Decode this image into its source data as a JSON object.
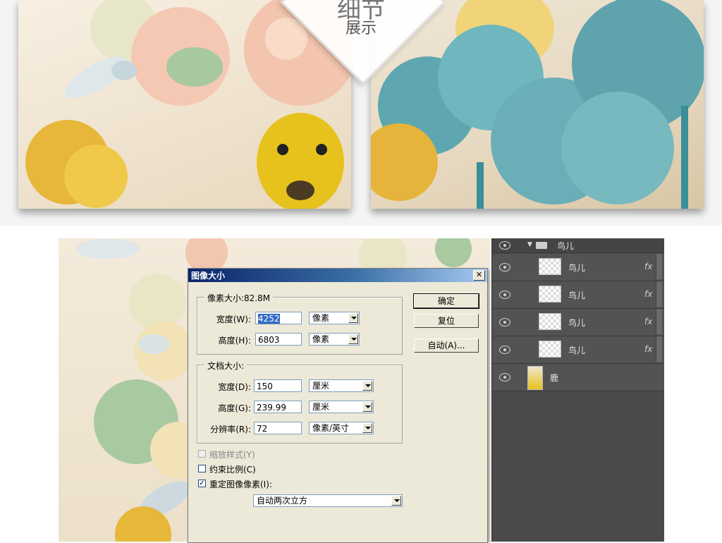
{
  "banner": {
    "title": "细节",
    "subtitle": "展示"
  },
  "dialog": {
    "title": "图像大小",
    "close": "✕",
    "pixel_group": {
      "legend": "像素大小:82.8M",
      "width_label": "宽度(W):",
      "width_value": "4252",
      "width_unit": "像素",
      "height_label": "高度(H):",
      "height_value": "6803",
      "height_unit": "像素"
    },
    "doc_group": {
      "legend": "文档大小:",
      "width_label": "宽度(D):",
      "width_value": "150",
      "width_unit": "厘米",
      "height_label": "高度(G):",
      "height_value": "239.99",
      "height_unit": "厘米",
      "res_label": "分辨率(R):",
      "res_value": "72",
      "res_unit": "像素/英寸"
    },
    "buttons": {
      "ok": "确定",
      "reset": "复位",
      "auto": "自动(A)..."
    },
    "options": {
      "scale_styles": "缩放样式(Y)",
      "constrain": "约束比例(C)",
      "resample": "重定图像像素(I):",
      "resample_checked": "✓",
      "resample_method": "自动两次立方"
    }
  },
  "layers": {
    "group_name": "鸟儿",
    "items": [
      {
        "name": "鸟儿",
        "fx": "fx"
      },
      {
        "name": "鸟儿",
        "fx": "fx"
      },
      {
        "name": "鸟儿",
        "fx": "fx"
      },
      {
        "name": "鸟儿",
        "fx": "fx"
      },
      {
        "name": "鹿",
        "fx": ""
      }
    ]
  },
  "colors": {
    "titlebar_start": "#0a246a",
    "dialog_bg": "#ece9d8",
    "layers_bg": "#4a4a4a"
  }
}
